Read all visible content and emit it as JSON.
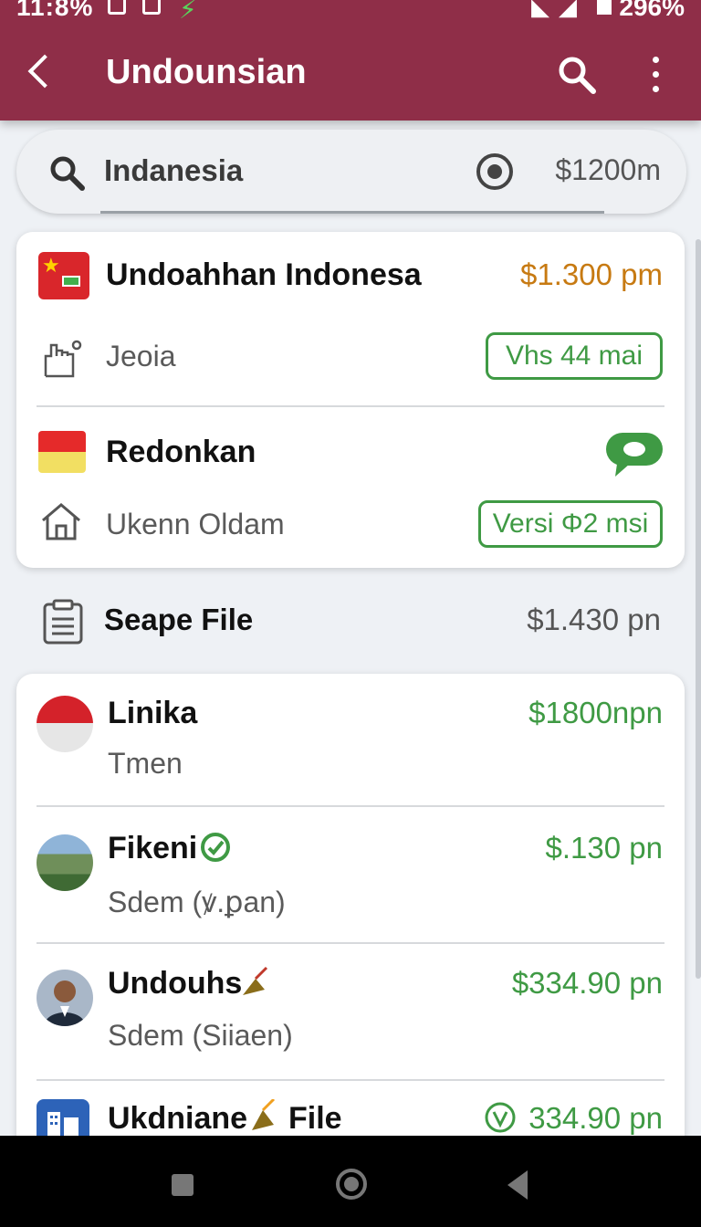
{
  "status": {
    "time": "11:8%",
    "battery": "296%"
  },
  "appbar": {
    "title": "Undounsian"
  },
  "search": {
    "value": "Indanesia",
    "price": "$1200m"
  },
  "card1": {
    "row1": {
      "title": "Undoahhan Indonesa",
      "amount": "$1.300 pm",
      "sub": "Jeoia",
      "pill": "Vhs 44 mai"
    },
    "row2": {
      "title": "Redonkan",
      "sub": "Ukenn Oldam",
      "pill": "Versi Φ2 msi"
    }
  },
  "section": {
    "title": "Seape File",
    "amount": "$1.430 pn"
  },
  "list": [
    {
      "title": "Linika",
      "sub": "Tmen",
      "amount": "$1800npn"
    },
    {
      "title": "Fikeni",
      "sub": "Sdem (ꝟ.ꝑan)",
      "amount": "$.130 pn"
    },
    {
      "title": "Undouhs",
      "sub": "Sdem (Siiaen)",
      "amount": "$334.90 pn"
    },
    {
      "title": "Ukdniane",
      "title2": "File",
      "amount": "334.90 pn"
    }
  ],
  "colors": {
    "appbar": "#8f2e48",
    "accent_green": "#3f9a44",
    "accent_orange": "#c77a12"
  }
}
